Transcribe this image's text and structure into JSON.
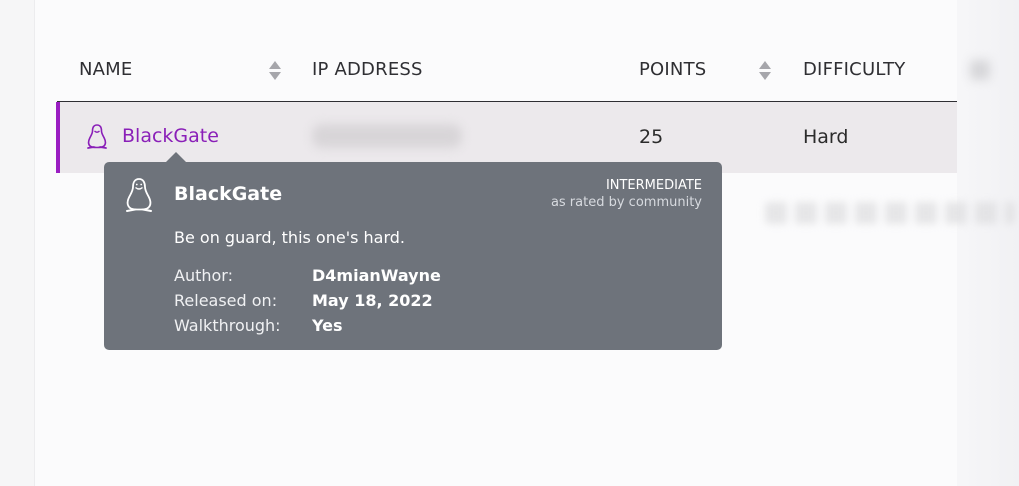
{
  "table": {
    "headers": {
      "name": "NAME",
      "ip": "IP ADDRESS",
      "points": "POINTS",
      "difficulty": "DIFFICULTY"
    },
    "rows": [
      {
        "name": "BlackGate",
        "points": "25",
        "difficulty": "Hard",
        "os_icon": "linux-penguin-icon"
      }
    ]
  },
  "tooltip": {
    "title": "BlackGate",
    "rating": "INTERMEDIATE",
    "rating_note": "as rated by community",
    "description": "Be on guard, this one's hard.",
    "details": [
      {
        "label": "Author:",
        "value": "D4mianWayne"
      },
      {
        "label": "Released on:",
        "value": "May 18, 2022"
      },
      {
        "label": "Walkthrough:",
        "value": "Yes"
      }
    ],
    "os_icon": "linux-penguin-icon"
  },
  "colors": {
    "accent": "#8a1fb8",
    "row_highlight": "#ece9ec",
    "tooltip_bg": "#6e737b"
  }
}
